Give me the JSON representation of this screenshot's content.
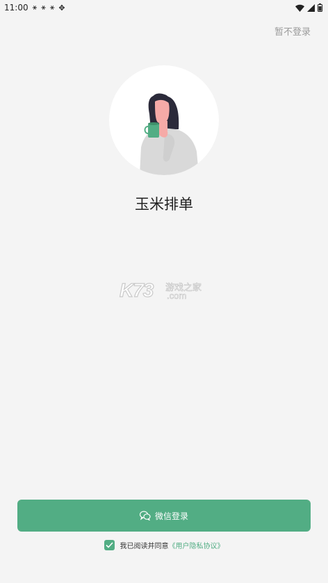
{
  "status_bar": {
    "time": "11:00",
    "notification_icons": [
      "notification-icon",
      "notification-icon",
      "notification-icon",
      "bug-icon"
    ],
    "right_icons": [
      "wifi-icon",
      "signal-icon",
      "battery-icon"
    ]
  },
  "header": {
    "skip_label": "暂不登录"
  },
  "main": {
    "app_name": "玉米排单",
    "illustration": "woman-drinking-coffee-illustration"
  },
  "watermark": {
    "main": "K73",
    "cn": "游戏之家",
    "com": ".com"
  },
  "login": {
    "wechat_button_label": "微信登录",
    "wechat_icon": "wechat-icon"
  },
  "agreement": {
    "checked": true,
    "prefix": "我已阅读并同意",
    "link": "《用户隐私协议》"
  },
  "colors": {
    "accent": "#52ad84",
    "background": "#f4f4f4"
  }
}
